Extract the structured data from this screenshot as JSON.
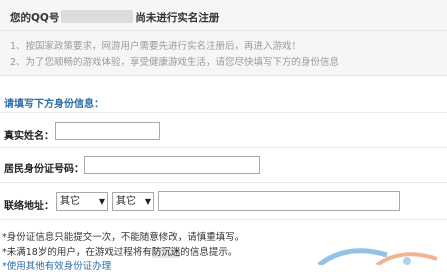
{
  "banner": {
    "title_prefix": "您的QQ号",
    "title_suffix": "尚未进行实名注册",
    "notices": [
      "1、按国家政策要求，网游用户需要先进行实名注册后，再进入游戏！",
      "2、为了您顺畅的游戏体验，享受健康游戏生活，请您尽快填写下方的身份信息"
    ]
  },
  "form": {
    "section_title": "请填写下方身份信息：",
    "real_name": {
      "label": "真实姓名：",
      "value": ""
    },
    "id_number": {
      "label": "居民身份证号码：",
      "value": ""
    },
    "address": {
      "label": "联络地址：",
      "province": "其它",
      "city": "其它",
      "detail_value": ""
    }
  },
  "notes": {
    "line1": "*身份证信息只能提交一次，不能随意修改，请慎重填写。",
    "line2_pre": "*未满18岁的用户，在游戏过程将有",
    "line2_hl": "防沉迷",
    "line2_post": "的信息提示。",
    "line3_partial": "*使用其他有效身份证办理"
  },
  "colors": {
    "section_title": "#2a6ea8",
    "notice_text": "#9a9a9a",
    "banner_bg": "#f6f6f6"
  }
}
